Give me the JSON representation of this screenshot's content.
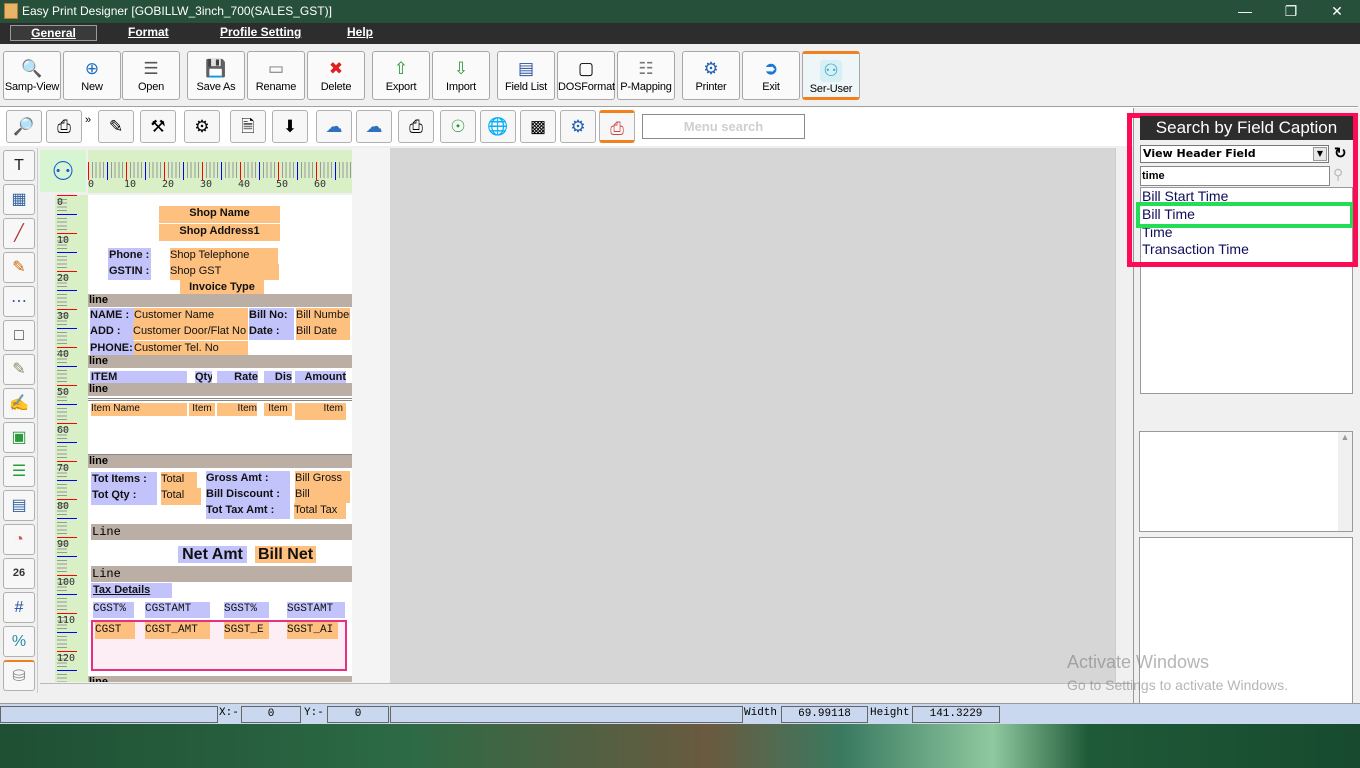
{
  "window": {
    "title": "Easy Print Designer [GOBILLW_3inch_700(SALES_GST)]",
    "controls": [
      "minimize",
      "restore",
      "close"
    ]
  },
  "menu": [
    {
      "label": "General",
      "selected": true
    },
    {
      "label": "Format"
    },
    {
      "label": "Profile Setting"
    },
    {
      "label": "Help"
    }
  ],
  "toolbar": [
    {
      "label": "Samp-View",
      "icon": "magnifier-page-icon"
    },
    {
      "label": "New",
      "icon": "new-doc-icon"
    },
    {
      "label": "Open",
      "icon": "open-icon"
    },
    {
      "label": "Save As",
      "icon": "floppy-icon"
    },
    {
      "label": "Rename",
      "icon": "rename-icon"
    },
    {
      "label": "Delete",
      "icon": "delete-icon"
    },
    {
      "label": "Export",
      "icon": "export-icon"
    },
    {
      "label": "Import",
      "icon": "import-icon"
    },
    {
      "label": "Field List",
      "icon": "field-list-icon"
    },
    {
      "label": "DOSFormat",
      "icon": "dos-format-icon"
    },
    {
      "label": "P-Mapping",
      "icon": "mapping-icon"
    },
    {
      "label": "Printer",
      "icon": "printer-gear-icon"
    },
    {
      "label": "Exit",
      "icon": "exit-icon"
    },
    {
      "label": "Ser-User",
      "icon": "user-icon",
      "active": true
    }
  ],
  "toolbar2": {
    "menu_search_placeholder": "Menu search",
    "overflow": "»"
  },
  "ruler": {
    "h": [
      "0",
      "10",
      "20",
      "30",
      "40",
      "50",
      "60"
    ],
    "v": [
      "0",
      "10",
      "20",
      "30",
      "40",
      "50",
      "60",
      "70",
      "80",
      "90",
      "100",
      "110",
      "120"
    ]
  },
  "design": {
    "shop_name": "Shop Name",
    "shop_address": "Shop Address1",
    "phone_label": "Phone :",
    "gstin_label": "GSTIN :",
    "shop_telephone": "Shop Telephone",
    "shop_gst": "Shop GST",
    "invoice_type": "Invoice Type",
    "line": "line",
    "Line": "Line",
    "name_label": "NAME  :",
    "add_label": "ADD    :",
    "phone2_label": "PHONE:",
    "customer_name": "Customer Name",
    "customer_door": "Customer Door/Flat No",
    "customer_tel": "Customer Tel. No",
    "bill_no_label": "Bill No:",
    "date_label": "Date   :",
    "bill_number": "Bill Number",
    "bill_date": "Bill Date",
    "item_headers": [
      "ITEM",
      "Qty",
      "Rate",
      "Dis",
      "Amount"
    ],
    "item_fields": [
      "Item Name",
      "Item",
      "Item",
      "Item",
      "Item"
    ],
    "tot_items_label": "Tot Items :",
    "tot_qty_label": "Tot Qty    :",
    "total1": "Total",
    "total2": "Total",
    "gross_label": "Gross Amt    :",
    "discount_label": "Bill Discount :",
    "tax_label": "Tot Tax Amt  :",
    "bill_gross": "Bill Gross",
    "bill": "Bill",
    "total_tax": "Total Tax",
    "net_amt_label": "Net Amt",
    "bill_net": "Bill Net",
    "tax_details": "Tax Details",
    "tax_headers": [
      "CGST%",
      "CGSTAMT",
      "SGST%",
      "SGSTAMT"
    ],
    "tax_fields": [
      "CGST",
      "CGST_AMT",
      "SGST_E",
      "SGST_AI"
    ]
  },
  "right_panel": {
    "title": "Search by Field Caption",
    "view_select": "View Header Field",
    "search_value": "time",
    "results": [
      "Bill Start Time",
      "Bill Time",
      "Time",
      "Transaction Time"
    ],
    "highlighted": "Bill Time",
    "highlight_color": "#22dd55",
    "frame_color": "#ff0a54"
  },
  "status": {
    "x_label": "X:-",
    "x": "0",
    "y_label": "Y:-",
    "y": "0",
    "width_label": "Width",
    "width": "69.99118",
    "height_label": "Height",
    "height": "141.3229"
  },
  "watermark": {
    "line1": "Activate Windows",
    "line2": "Go to Settings to activate Windows."
  }
}
